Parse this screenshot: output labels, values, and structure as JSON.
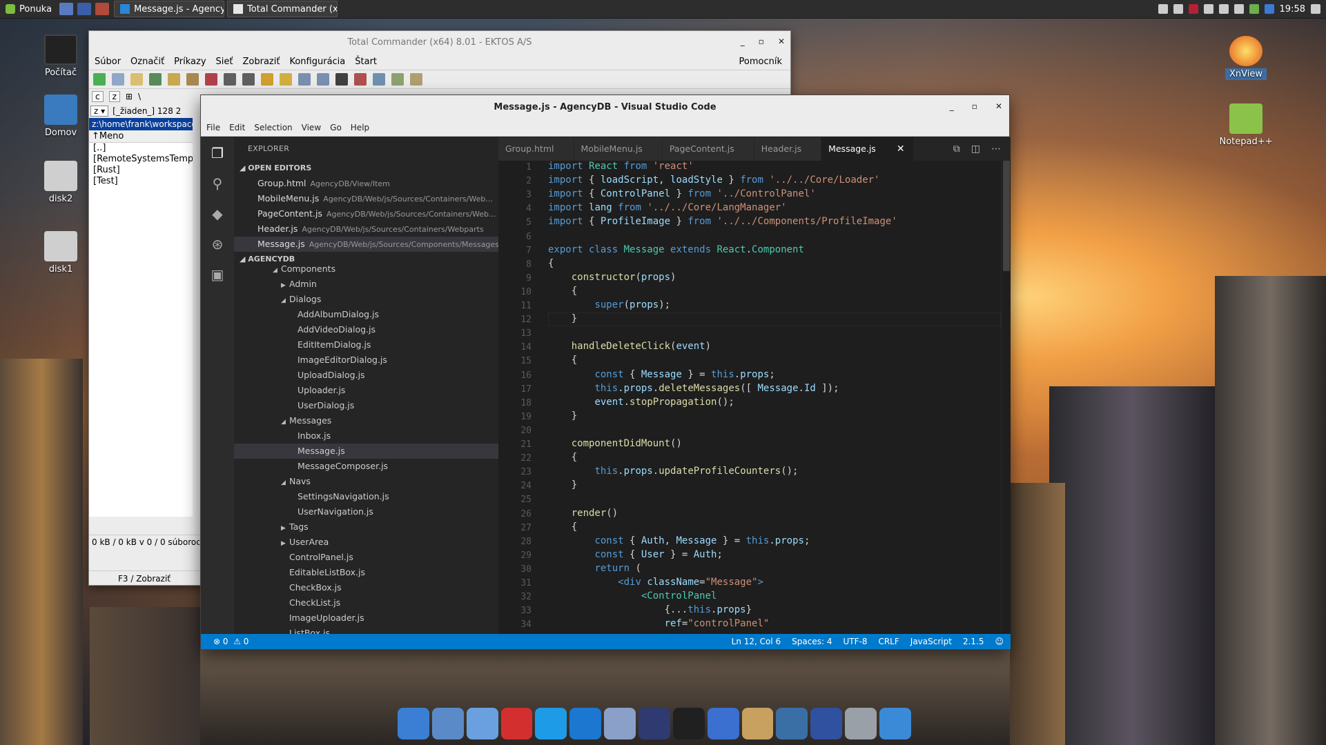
{
  "panel": {
    "menu_label": "Ponuka",
    "tasks": [
      {
        "label": "Message.js - Agency..."
      },
      {
        "label": "Total Commander (x..."
      }
    ],
    "clock": "19:58"
  },
  "desktop": {
    "icons": [
      {
        "label": "Počítač"
      },
      {
        "label": "Domov"
      },
      {
        "label": "disk2"
      },
      {
        "label": "disk1"
      },
      {
        "label": "XnView"
      },
      {
        "label": "Notepad++"
      }
    ]
  },
  "tc": {
    "title": "Total Commander (x64) 8.01 - EKTOS A/S",
    "menu": [
      "Súbor",
      "Označiť",
      "Príkazy",
      "Sieť",
      "Zobraziť",
      "Konfigurácia",
      "Štart"
    ],
    "help": "Pomocník",
    "drive_c": "c",
    "drive_z": "z",
    "path_drive": "z",
    "path_info": "[_žiaden_]  128 2",
    "root": "\\",
    "current_path": "z:\\home\\frank\\workspace",
    "list_header": "Meno",
    "files": [
      "[..]",
      "[RemoteSystemsTemp",
      "[Rust]",
      "[Test]"
    ],
    "status": "0 kB / 0 kB v 0 / 0 súboroch",
    "f3": "F3 / Zobraziť"
  },
  "vscode": {
    "title": "Message.js - AgencyDB - Visual Studio Code",
    "menu": [
      "File",
      "Edit",
      "Selection",
      "View",
      "Go",
      "Help"
    ],
    "explorer_title": "EXPLORER",
    "open_editors_label": "OPEN EDITORS",
    "open_editors": [
      {
        "name": "Group.html",
        "path": "AgencyDB/View/Item"
      },
      {
        "name": "MobileMenu.js",
        "path": "AgencyDB/Web/js/Sources/Containers/Web..."
      },
      {
        "name": "PageContent.js",
        "path": "AgencyDB/Web/js/Sources/Containers/Web..."
      },
      {
        "name": "Header.js",
        "path": "AgencyDB/Web/js/Sources/Containers/Webparts"
      },
      {
        "name": "Message.js",
        "path": "AgencyDB/Web/js/Sources/Components/Messages"
      }
    ],
    "project_label": "AGENCYDB",
    "tree": [
      {
        "label": "Components",
        "caret": "◢",
        "indent": 1
      },
      {
        "label": "Admin",
        "caret": "▶",
        "indent": 2
      },
      {
        "label": "Dialogs",
        "caret": "◢",
        "indent": 2
      },
      {
        "label": "AddAlbumDialog.js",
        "caret": "",
        "indent": 3
      },
      {
        "label": "AddVideoDialog.js",
        "caret": "",
        "indent": 3
      },
      {
        "label": "EditItemDialog.js",
        "caret": "",
        "indent": 3
      },
      {
        "label": "ImageEditorDialog.js",
        "caret": "",
        "indent": 3
      },
      {
        "label": "UploadDialog.js",
        "caret": "",
        "indent": 3
      },
      {
        "label": "Uploader.js",
        "caret": "",
        "indent": 3
      },
      {
        "label": "UserDialog.js",
        "caret": "",
        "indent": 3
      },
      {
        "label": "Messages",
        "caret": "◢",
        "indent": 2
      },
      {
        "label": "Inbox.js",
        "caret": "",
        "indent": 3
      },
      {
        "label": "Message.js",
        "caret": "",
        "indent": 3
      },
      {
        "label": "MessageComposer.js",
        "caret": "",
        "indent": 3
      },
      {
        "label": "Navs",
        "caret": "◢",
        "indent": 2
      },
      {
        "label": "SettingsNavigation.js",
        "caret": "",
        "indent": 3
      },
      {
        "label": "UserNavigation.js",
        "caret": "",
        "indent": 3
      },
      {
        "label": "Tags",
        "caret": "▶",
        "indent": 2
      },
      {
        "label": "UserArea",
        "caret": "▶",
        "indent": 2
      },
      {
        "label": "ControlPanel.js",
        "caret": "",
        "indent": 2
      },
      {
        "label": "EditableListBox.js",
        "caret": "",
        "indent": 2
      },
      {
        "label": "CheckBox.js",
        "caret": "",
        "indent": 2
      },
      {
        "label": "CheckList.js",
        "caret": "",
        "indent": 2
      },
      {
        "label": "ImageUploader.js",
        "caret": "",
        "indent": 2
      },
      {
        "label": "ListBox.js",
        "caret": "",
        "indent": 2
      }
    ],
    "tabs": [
      "Group.html",
      "MobileMenu.js",
      "PageContent.js",
      "Header.js",
      "Message.js"
    ],
    "code": [
      [
        [
          "kw",
          "import "
        ],
        [
          "ty",
          "React"
        ],
        [
          "kw",
          " from "
        ],
        [
          "st",
          "'react'"
        ]
      ],
      [
        [
          "kw",
          "import "
        ],
        [
          "pl",
          "{ "
        ],
        [
          "vr",
          "loadScript"
        ],
        [
          "pl",
          ", "
        ],
        [
          "vr",
          "loadStyle"
        ],
        [
          "pl",
          " } "
        ],
        [
          "kw",
          "from "
        ],
        [
          "st",
          "'../../Core/Loader'"
        ]
      ],
      [
        [
          "kw",
          "import "
        ],
        [
          "pl",
          "{ "
        ],
        [
          "vr",
          "ControlPanel"
        ],
        [
          "pl",
          " } "
        ],
        [
          "kw",
          "from "
        ],
        [
          "st",
          "'../ControlPanel'"
        ]
      ],
      [
        [
          "kw",
          "import "
        ],
        [
          "vr",
          "lang"
        ],
        [
          "kw",
          " from "
        ],
        [
          "st",
          "'../../Core/LangManager'"
        ]
      ],
      [
        [
          "kw",
          "import "
        ],
        [
          "pl",
          "{ "
        ],
        [
          "vr",
          "ProfileImage"
        ],
        [
          "pl",
          " } "
        ],
        [
          "kw",
          "from "
        ],
        [
          "st",
          "'../../Components/ProfileImage'"
        ]
      ],
      [],
      [
        [
          "kw",
          "export class "
        ],
        [
          "ty",
          "Message"
        ],
        [
          "kw",
          " extends "
        ],
        [
          "ty",
          "React"
        ],
        [
          "pl",
          "."
        ],
        [
          "ty",
          "Component"
        ]
      ],
      [
        [
          "pl",
          "{"
        ]
      ],
      [
        [
          "pl",
          "    "
        ],
        [
          "fn",
          "constructor"
        ],
        [
          "pl",
          "("
        ],
        [
          "vr",
          "props"
        ],
        [
          "pl",
          ")"
        ]
      ],
      [
        [
          "pl",
          "    {"
        ]
      ],
      [
        [
          "pl",
          "        "
        ],
        [
          "kw",
          "super"
        ],
        [
          "pl",
          "("
        ],
        [
          "vr",
          "props"
        ],
        [
          "pl",
          ");"
        ]
      ],
      [
        [
          "pl",
          "    }"
        ]
      ],
      [],
      [
        [
          "pl",
          "    "
        ],
        [
          "fn",
          "handleDeleteClick"
        ],
        [
          "pl",
          "("
        ],
        [
          "vr",
          "event"
        ],
        [
          "pl",
          ")"
        ]
      ],
      [
        [
          "pl",
          "    {"
        ]
      ],
      [
        [
          "pl",
          "        "
        ],
        [
          "kw",
          "const "
        ],
        [
          "pl",
          "{ "
        ],
        [
          "vr",
          "Message"
        ],
        [
          "pl",
          " } = "
        ],
        [
          "kw",
          "this"
        ],
        [
          "pl",
          "."
        ],
        [
          "vr",
          "props"
        ],
        [
          "pl",
          ";"
        ]
      ],
      [
        [
          "pl",
          "        "
        ],
        [
          "kw",
          "this"
        ],
        [
          "pl",
          "."
        ],
        [
          "vr",
          "props"
        ],
        [
          "pl",
          "."
        ],
        [
          "fn",
          "deleteMessages"
        ],
        [
          "pl",
          "([ "
        ],
        [
          "vr",
          "Message"
        ],
        [
          "pl",
          "."
        ],
        [
          "vr",
          "Id"
        ],
        [
          "pl",
          " ]);"
        ]
      ],
      [
        [
          "pl",
          "        "
        ],
        [
          "vr",
          "event"
        ],
        [
          "pl",
          "."
        ],
        [
          "fn",
          "stopPropagation"
        ],
        [
          "pl",
          "();"
        ]
      ],
      [
        [
          "pl",
          "    }"
        ]
      ],
      [],
      [
        [
          "pl",
          "    "
        ],
        [
          "fn",
          "componentDidMount"
        ],
        [
          "pl",
          "()"
        ]
      ],
      [
        [
          "pl",
          "    {"
        ]
      ],
      [
        [
          "pl",
          "        "
        ],
        [
          "kw",
          "this"
        ],
        [
          "pl",
          "."
        ],
        [
          "vr",
          "props"
        ],
        [
          "pl",
          "."
        ],
        [
          "fn",
          "updateProfileCounters"
        ],
        [
          "pl",
          "();"
        ]
      ],
      [
        [
          "pl",
          "    }"
        ]
      ],
      [],
      [
        [
          "pl",
          "    "
        ],
        [
          "fn",
          "render"
        ],
        [
          "pl",
          "()"
        ]
      ],
      [
        [
          "pl",
          "    {"
        ]
      ],
      [
        [
          "pl",
          "        "
        ],
        [
          "kw",
          "const "
        ],
        [
          "pl",
          "{ "
        ],
        [
          "vr",
          "Auth"
        ],
        [
          "pl",
          ", "
        ],
        [
          "vr",
          "Message"
        ],
        [
          "pl",
          " } = "
        ],
        [
          "kw",
          "this"
        ],
        [
          "pl",
          "."
        ],
        [
          "vr",
          "props"
        ],
        [
          "pl",
          ";"
        ]
      ],
      [
        [
          "pl",
          "        "
        ],
        [
          "kw",
          "const "
        ],
        [
          "pl",
          "{ "
        ],
        [
          "vr",
          "User"
        ],
        [
          "pl",
          " } = "
        ],
        [
          "vr",
          "Auth"
        ],
        [
          "pl",
          ";"
        ]
      ],
      [
        [
          "pl",
          "        "
        ],
        [
          "kw",
          "return "
        ],
        [
          "pl",
          "("
        ]
      ],
      [
        [
          "pl",
          "            "
        ],
        [
          "kw",
          "<div "
        ],
        [
          "vr",
          "className"
        ],
        [
          "pl",
          "="
        ],
        [
          "st",
          "\"Message\""
        ],
        [
          "kw",
          ">"
        ]
      ],
      [
        [
          "pl",
          "                "
        ],
        [
          "ty",
          "<ControlPanel"
        ]
      ],
      [
        [
          "pl",
          "                    {..."
        ],
        [
          "kw",
          "this"
        ],
        [
          "pl",
          "."
        ],
        [
          "vr",
          "props"
        ],
        [
          "pl",
          "}"
        ]
      ],
      [
        [
          "pl",
          "                    "
        ],
        [
          "vr",
          "ref"
        ],
        [
          "pl",
          "="
        ],
        [
          "st",
          "\"controlPanel\""
        ]
      ]
    ],
    "status": {
      "errors": "0",
      "warnings": "0",
      "position": "Ln 12, Col 6",
      "spaces": "Spaces: 4",
      "encoding": "UTF-8",
      "eol": "CRLF",
      "language": "JavaScript",
      "version": "2.1.5"
    }
  },
  "dock_icons": [
    "anchor-icon",
    "files-icon",
    "chromium-icon",
    "opera-icon",
    "skype-icon",
    "vscode-icon",
    "settings-icon",
    "eclipse-icon",
    "terminal-icon",
    "qbittorrent-icon",
    "archive-icon",
    "network-icon",
    "save-icon",
    "trash-icon",
    "desktop-icon"
  ]
}
